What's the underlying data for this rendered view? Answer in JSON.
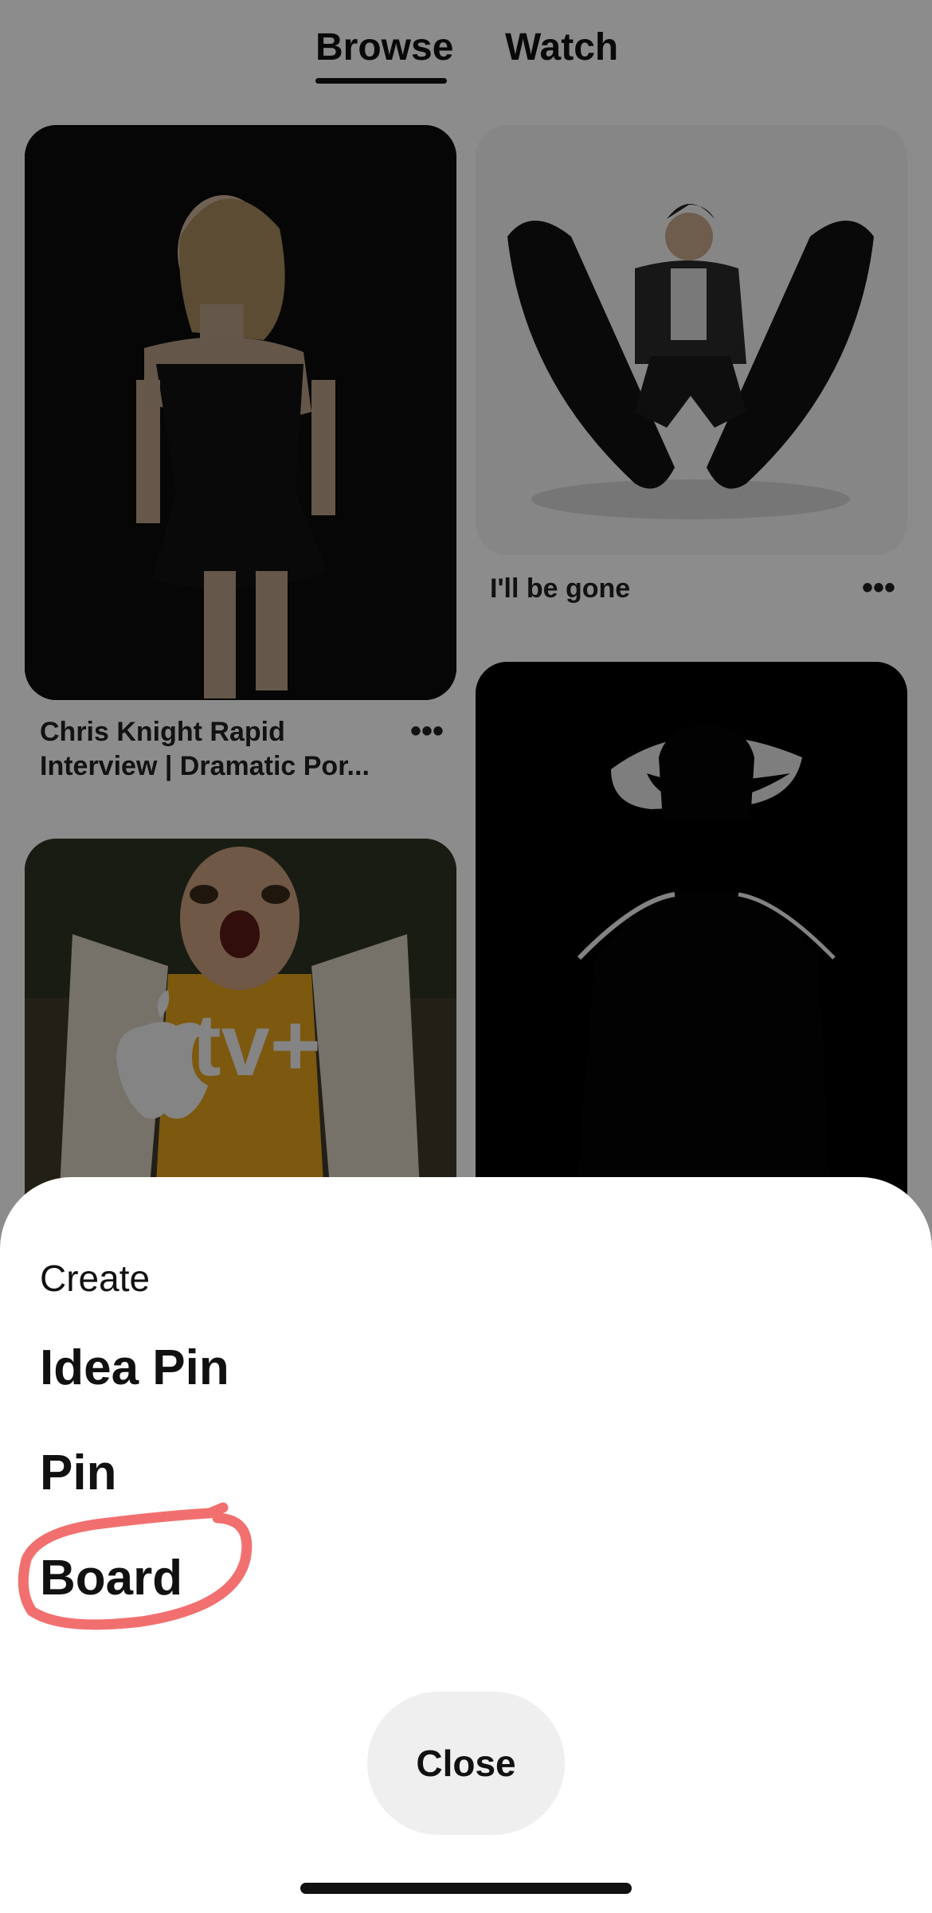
{
  "tabs": {
    "browse": "Browse",
    "watch": "Watch",
    "active": "Browse"
  },
  "pins": [
    {
      "title_line1": "Chris Knight Rapid",
      "title_line2": "Interview | Dramatic Por...",
      "more": "•••"
    },
    {
      "title_line1": "I'll be gone",
      "title_line2": "",
      "more": "•••"
    },
    {
      "overlay_text": "tv+"
    },
    {
      "title_line1": "",
      "title_line2": ""
    }
  ],
  "sheet": {
    "heading": "Create",
    "items": [
      "Idea Pin",
      "Pin",
      "Board"
    ],
    "highlighted_item": "Board",
    "annotation_color": "#f0605f",
    "close_label": "Close"
  },
  "colors": {
    "background": "#ffffff",
    "text": "#111111",
    "close_button_bg": "#efefef",
    "scrim": "rgba(0,0,0,0.45)"
  }
}
